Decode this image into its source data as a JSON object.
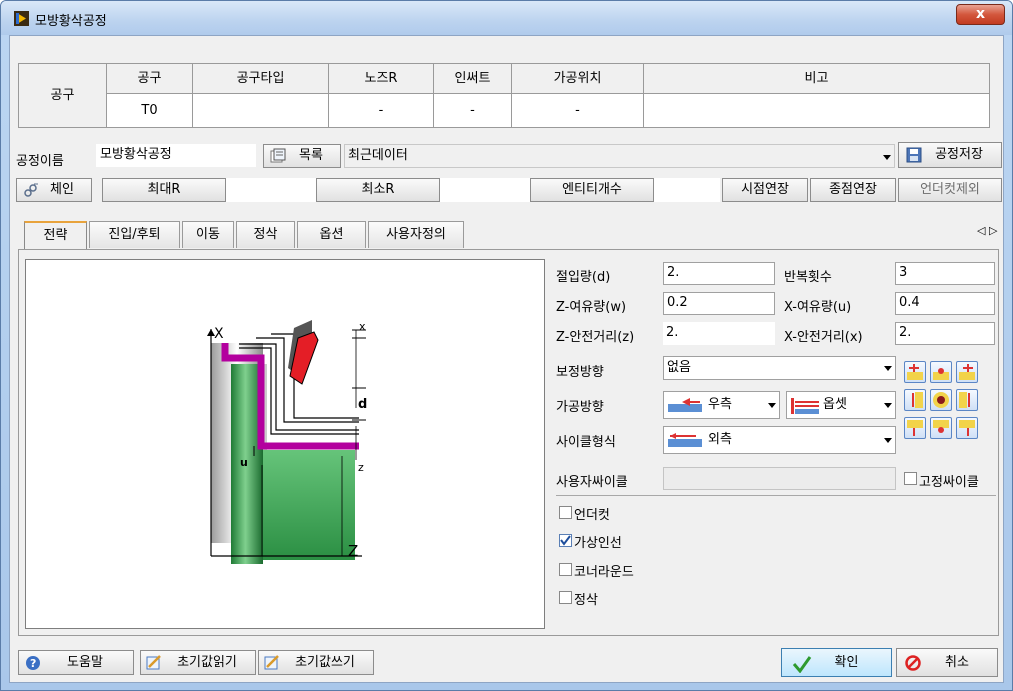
{
  "window": {
    "title": "모방황삭공정",
    "close_label": "x"
  },
  "tool_table": {
    "row_label": "공구",
    "headers": [
      "공구",
      "공구타입",
      "노즈R",
      "인써트",
      "가공위치",
      "비고"
    ],
    "values": [
      "T0",
      "",
      "-",
      "-",
      "-",
      ""
    ]
  },
  "process": {
    "name_label": "공정이름",
    "name_value": "모방황삭공정",
    "list_button": "목록",
    "recent_value": "최근데이터",
    "save_button": "공정저장"
  },
  "chain": {
    "chain_button": "체인",
    "max_r_label": "최대R",
    "max_r_value": "",
    "min_r_label": "최소R",
    "min_r_value": "",
    "entity_label": "엔티티개수",
    "entity_value": "",
    "start_ext": "시점연장",
    "end_ext": "종점연장",
    "undercut_remove": "언더컷제외"
  },
  "tabs": [
    "전략",
    "진입/후퇴",
    "이동",
    "정삭",
    "옵션",
    "사용자정의"
  ],
  "tab_scroll": "◁ ▷",
  "diagram": {
    "x": "X",
    "z": "Z",
    "x_small": "x",
    "d": "d",
    "u": "u",
    "z_small": "z"
  },
  "params": {
    "cut_depth_label": "절입량(d)",
    "cut_depth": "2.",
    "repeat_label": "반복횟수",
    "repeat": "3",
    "z_allow_label": "Z-여유량(w)",
    "z_allow": "0.2",
    "x_allow_label": "X-여유량(u)",
    "x_allow": "0.4",
    "z_safe_label": "Z-안전거리(z)",
    "z_safe": "2.",
    "x_safe_label": "X-안전거리(x)",
    "x_safe": "2.",
    "comp_label": "보정방향",
    "comp_value": "없음",
    "dir_label": "가공방향",
    "dir_value": "우측",
    "offset_value": "옵셋",
    "cycle_label": "사이클형식",
    "cycle_value": "외측",
    "user_cycle_label": "사용자싸이클",
    "user_cycle_value": "",
    "fixed_cycle_label": "고정싸이클"
  },
  "options": [
    {
      "label": "언더컷",
      "checked": false
    },
    {
      "label": "가상인선",
      "checked": true
    },
    {
      "label": "코너라운드",
      "checked": false
    },
    {
      "label": "정삭",
      "checked": false
    }
  ],
  "footer": {
    "help": "도움말",
    "read_default": "초기값읽기",
    "write_default": "초기값쓰기",
    "ok": "확인",
    "cancel": "취소"
  },
  "colors": {
    "accent": "#e8a33c",
    "part_green": "#2f9e47",
    "tool_red": "#e41e26",
    "path_magenta": "#b3009e"
  }
}
